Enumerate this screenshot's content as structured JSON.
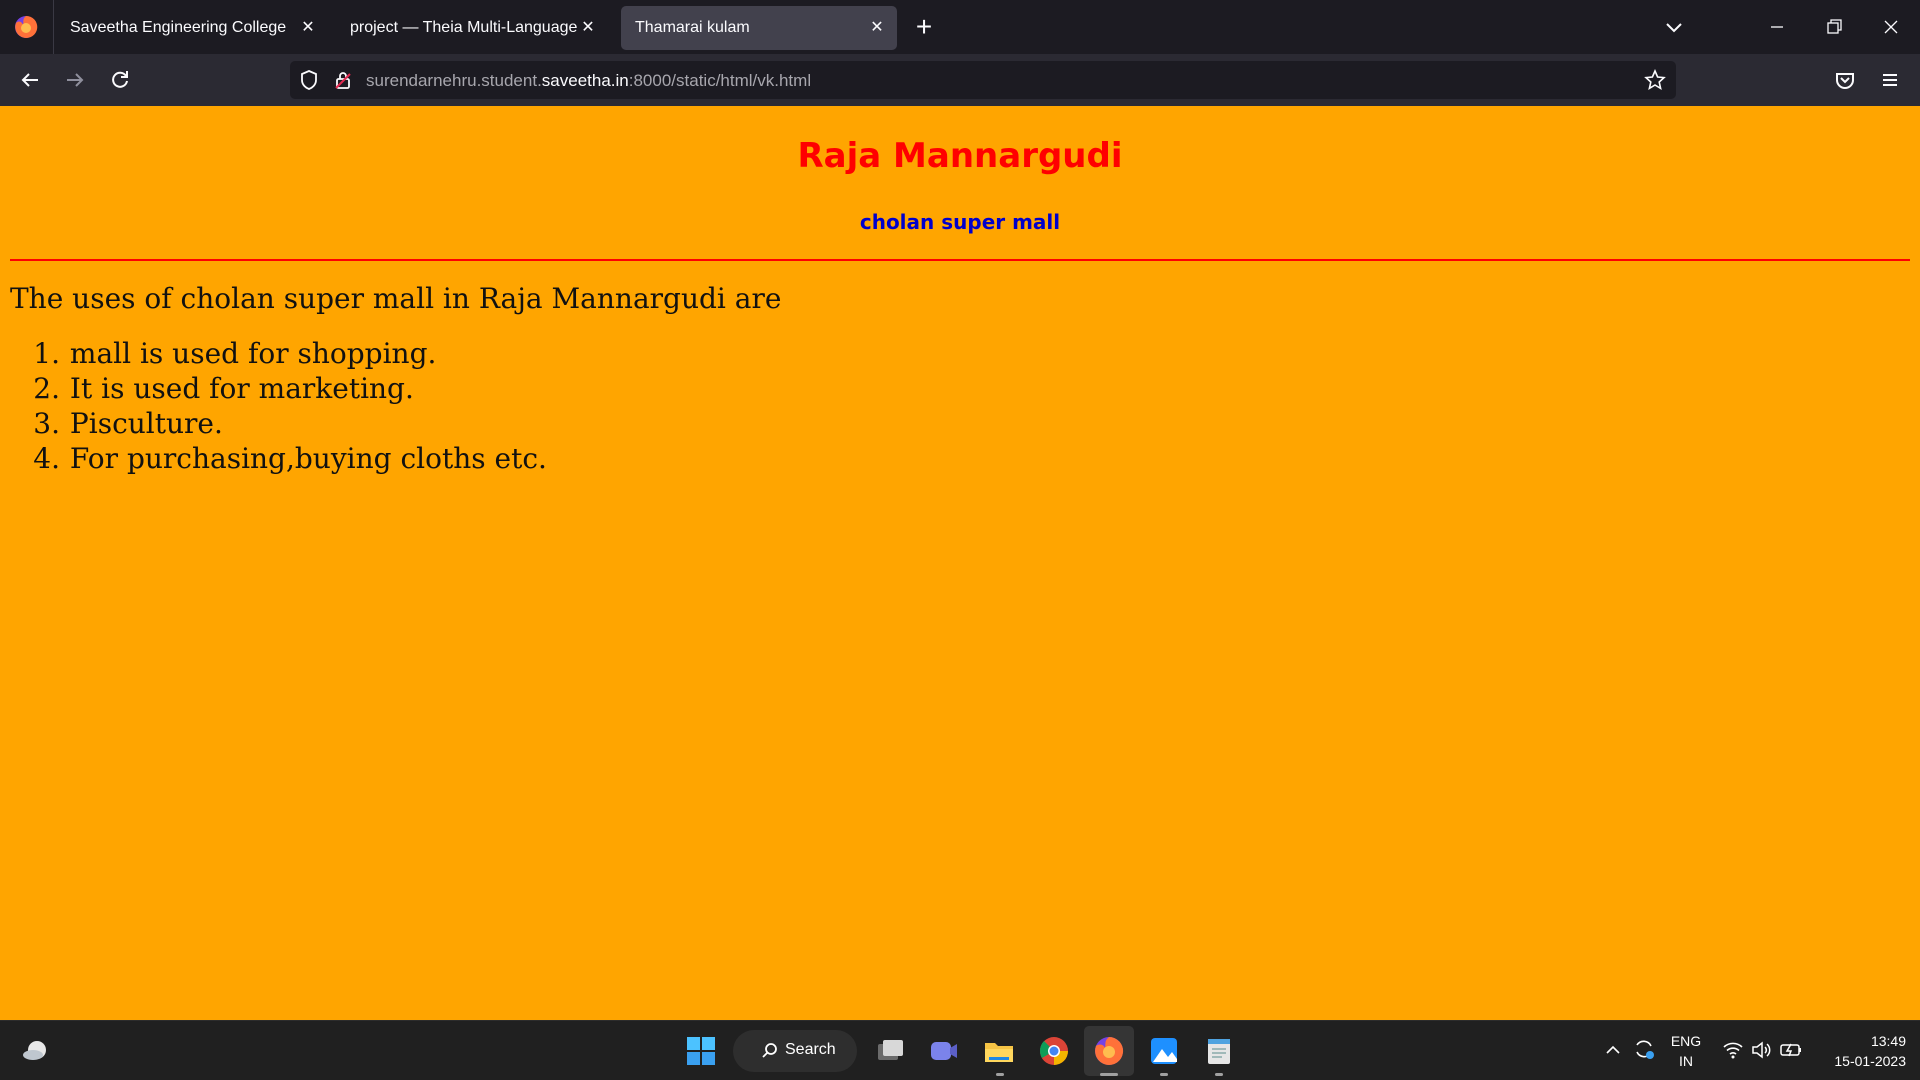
{
  "browser": {
    "tabs": [
      {
        "title": "Saveetha Engineering College",
        "active": false
      },
      {
        "title": "project — Theia Multi-Language Ex",
        "active": false
      },
      {
        "title": "Thamarai kulam",
        "active": true
      }
    ],
    "tab_close_glyph": "✕",
    "new_tab_glyph": "+",
    "url": {
      "prefix": "surendarnehru.student.",
      "domain": "saveetha.in",
      "suffix": ":8000/static/html/vk.html"
    },
    "icons": [
      "firefox-icon",
      "back-icon",
      "forward-icon",
      "reload-icon",
      "shield-icon",
      "lock-icon",
      "bookmark-star-icon",
      "pocket-icon",
      "menu-icon",
      "tabs-list-icon",
      "minimize-icon",
      "restore-icon",
      "close-icon"
    ]
  },
  "page": {
    "title": "Raja Mannargudi",
    "subtitle": "cholan super mall",
    "intro": "The uses of cholan super mall in Raja Mannargudi are",
    "items": [
      {
        "num": "1.",
        "text": "mall is used for shopping."
      },
      {
        "num": "2.",
        "text": "It is used for marketing."
      },
      {
        "num": "3.",
        "text": "Pisculture."
      },
      {
        "num": "4.",
        "text": "For purchasing,buying cloths etc."
      }
    ],
    "background_color": "#ffa500",
    "title_color": "#ff0000",
    "subtitle_color": "#0000cd"
  },
  "taskbar": {
    "search_label": "Search",
    "lang_line1": "ENG",
    "lang_line2": "IN",
    "time": "13:49",
    "date": "15-01-2023",
    "apps": [
      "weather-icon",
      "start-icon",
      "search-icon",
      "task-view-icon",
      "teams-icon",
      "file-explorer-icon",
      "chrome-icon",
      "firefox-icon",
      "photos-icon",
      "notepad-icon"
    ]
  }
}
